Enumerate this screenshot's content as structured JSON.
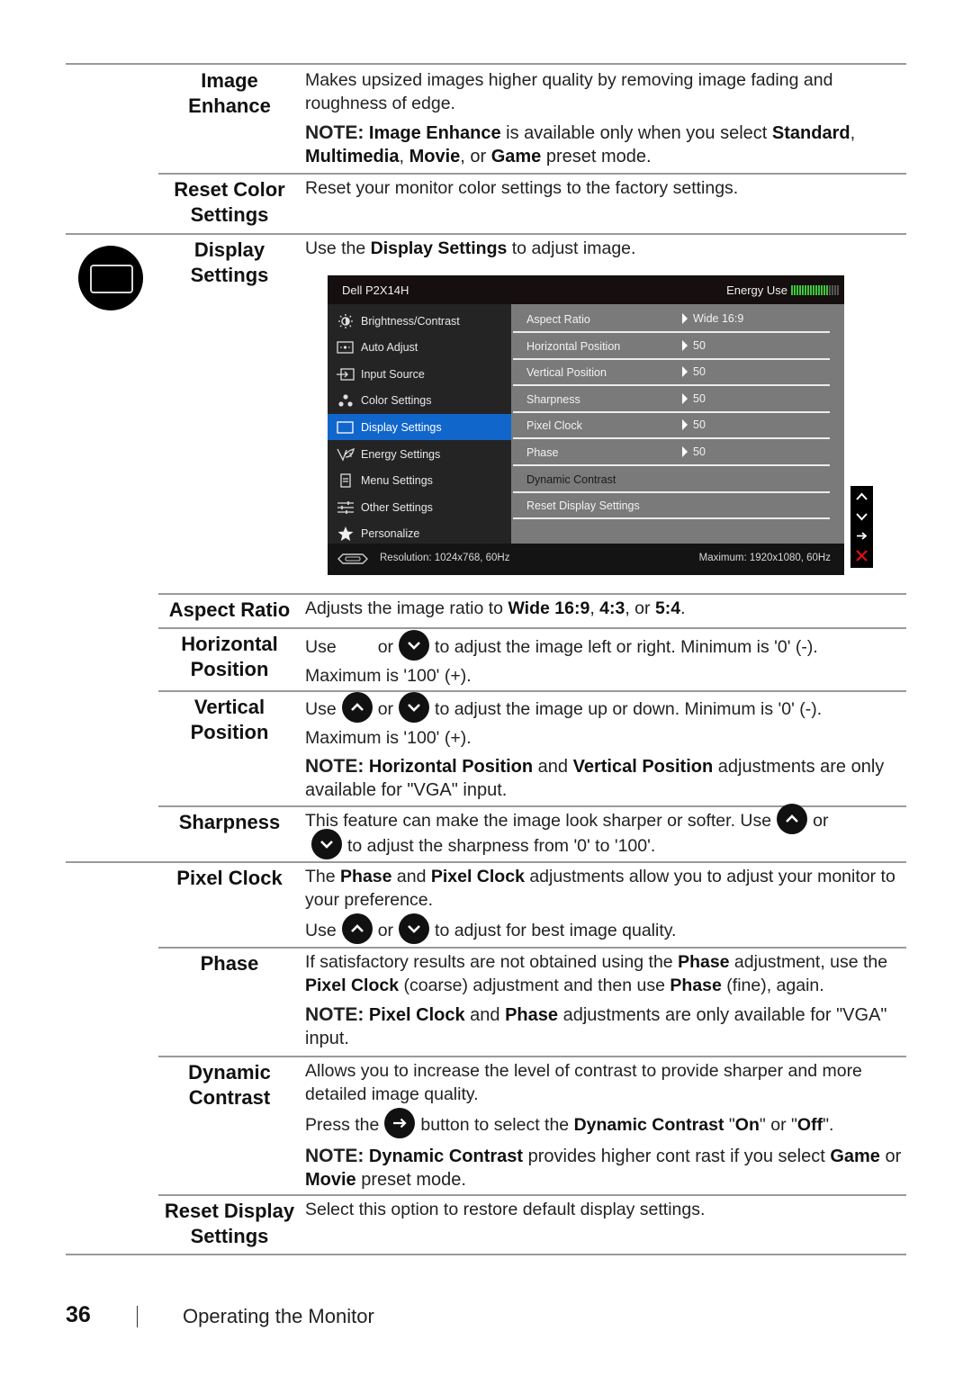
{
  "rows": {
    "image_enhance": {
      "term": [
        "Image",
        "Enhance"
      ],
      "desc": "Makes upsized images higher quality by removing image fading and roughness of edge.",
      "note_label": "NOTE:",
      "note_parts": [
        "Image Enhance",
        " is available only when you select ",
        "Standard",
        ", ",
        "Multimedia",
        ", ",
        "Movie",
        ", or ",
        "Game",
        " preset mode."
      ]
    },
    "reset_color": {
      "term": [
        "Reset Color",
        "Settings"
      ],
      "desc": "Reset your monitor color settings to the factory settings."
    },
    "display_settings": {
      "term": [
        "Display",
        "Settings"
      ],
      "desc_pre": "Use the ",
      "desc_bold": "Display Settings",
      "desc_post": " to adjust image."
    },
    "aspect_ratio": {
      "term": "Aspect Ratio",
      "desc_parts": [
        "Adjusts the image ratio to ",
        "Wide 16:9",
        ", ",
        "4:3",
        ", or ",
        "5:4",
        "."
      ]
    },
    "horizontal_position": {
      "term": [
        "Horizontal",
        "Position"
      ],
      "use": "Use",
      "or": "or",
      "desc": "to adjust the image left or right. Minimum is '0' (-).",
      "max": "Maximum is '100' (+)."
    },
    "vertical_position": {
      "term": [
        "Vertical",
        "Position"
      ],
      "use": "Use",
      "or": "or",
      "desc": "to adjust the image up or down. Minimum is '0' (-).",
      "max": "Maximum is '100' (+).",
      "note_label": "NOTE:",
      "note_parts": [
        "Horizontal Position",
        " and ",
        "Vertical Position",
        " adjustments are only available for \"VGA\" input."
      ]
    },
    "sharpness": {
      "term": "Sharpness",
      "desc_a": "This feature can make the image look sharper or softer. Use",
      "or": "or",
      "desc_b": "to adjust the sharpness from '0' to '100'."
    },
    "pixel_clock": {
      "term": "Pixel Clock",
      "desc_parts": [
        "The ",
        "Phase",
        " and ",
        "Pixel Clock",
        " adjustments allow you to adjust your monitor to your preference."
      ],
      "use": "Use",
      "or": "or",
      "desc_b": "to adjust for best image quality."
    },
    "phase": {
      "term": "Phase",
      "desc_parts": [
        "If satisfactory results are not obtained using the ",
        "Phase",
        " adjustment, use the ",
        "Pixel Clock",
        " (coarse) adjustment and then use ",
        "Phase",
        " (fine), again."
      ],
      "note_label": "NOTE:",
      "note_parts": [
        "Pixel Clock",
        " and ",
        "Phase",
        " adjustments are only available for \"VGA\" input."
      ]
    },
    "dynamic_contrast": {
      "term": [
        "Dynamic",
        "Contrast"
      ],
      "desc": "Allows you to increase the level of contrast to provide sharper and more detailed image quality.",
      "press": "Press the",
      "press_parts": [
        "button to select the ",
        "Dynamic Contrast",
        " \"",
        "On",
        "\" or \"",
        "Off",
        "\"."
      ],
      "note_label": "NOTE:",
      "note_parts": [
        "Dynamic Contrast",
        " provides higher cont rast if you select ",
        "Game",
        " or ",
        "Movie",
        " preset mode."
      ]
    },
    "reset_display": {
      "term": [
        "Reset Display",
        "Settings"
      ],
      "desc": "Select this option to restore default display settings."
    }
  },
  "osd": {
    "model": "Dell P2X14H",
    "energy_label": "Energy Use",
    "energy_level": {
      "on": 14,
      "total": 18
    },
    "energy_color": "#3bc93b",
    "accent": "#1166cc",
    "menu": [
      {
        "label": "Brightness/Contrast",
        "icon": "brightness-icon"
      },
      {
        "label": "Auto Adjust",
        "icon": "auto-adjust-icon"
      },
      {
        "label": "Input Source",
        "icon": "input-source-icon"
      },
      {
        "label": "Color Settings",
        "icon": "color-settings-icon"
      },
      {
        "label": "Display Settings",
        "icon": "display-settings-icon",
        "active": true
      },
      {
        "label": "Energy Settings",
        "icon": "energy-settings-icon"
      },
      {
        "label": "Menu Settings",
        "icon": "menu-settings-icon"
      },
      {
        "label": "Other Settings",
        "icon": "other-settings-icon"
      },
      {
        "label": "Personalize",
        "icon": "star-icon"
      }
    ],
    "submenu": [
      {
        "label": "Aspect Ratio",
        "value": "Wide 16:9"
      },
      {
        "label": "Horizontal Position",
        "value": "50"
      },
      {
        "label": "Vertical Position",
        "value": "50"
      },
      {
        "label": "Sharpness",
        "value": "50"
      },
      {
        "label": "Pixel Clock",
        "value": "50"
      },
      {
        "label": "Phase",
        "value": "50"
      },
      {
        "label": "Dynamic Contrast",
        "value": null
      },
      {
        "label": "Reset Display Settings",
        "value": null
      }
    ],
    "resolution": "Resolution: 1024x768, 60Hz",
    "maximum": "Maximum: 1920x1080, 60Hz",
    "keys": [
      "up-icon",
      "down-icon",
      "enter-arrow-icon",
      "exit-x-icon"
    ]
  },
  "footer": {
    "page_number": "36",
    "chapter": "Operating the Monitor"
  }
}
